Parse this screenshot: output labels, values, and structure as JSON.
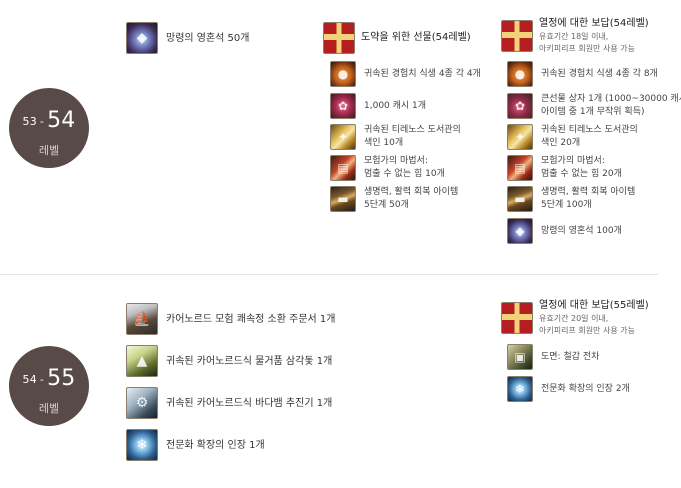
{
  "levels": [
    {
      "from": "53",
      "dash": "-",
      "to": "54",
      "label": "레벨"
    },
    {
      "from": "54",
      "dash": "-",
      "to": "55",
      "label": "레벨"
    }
  ],
  "section1": {
    "col1": [
      {
        "icon": "crystal-icon",
        "text": "망령의 영혼석 50개"
      }
    ],
    "col2": {
      "header": {
        "icon": "gift-box-icon",
        "title": "도약을 위한 선물(54레벨)"
      },
      "items": [
        {
          "icon": "pumpkin-icon",
          "line1": "귀속된 경험치 식생 4종 각 4개",
          "line2": ""
        },
        {
          "icon": "cash-icon",
          "line1": "1,000 캐시 1개",
          "line2": ""
        },
        {
          "icon": "book-icon",
          "line1": "귀속된 티레노스 도서관의",
          "line2": "색인 10개"
        },
        {
          "icon": "magic-book-icon",
          "line1": "모험가의 마법서:",
          "line2": "멈출 수 없는 힘 10개"
        },
        {
          "icon": "potion-icon",
          "line1": "생명력, 활력 회복 아이템",
          "line2": "5단계 50개"
        }
      ]
    },
    "col3": {
      "header": {
        "icon": "gift-box-icon",
        "title": "열정에 대한 보답(54레벨)",
        "sub1": "유효기간 18일 이내,",
        "sub2": "아키피리프 회원만 사용 가능"
      },
      "items": [
        {
          "icon": "pumpkin-icon",
          "line1": "귀속된 경험치 식생 4종 각 8개",
          "line2": ""
        },
        {
          "icon": "mystery-box-icon",
          "line1": "큰선물 상자 1개 (1000~30000 캐시",
          "line2": "아이템 중 1개 무작위 획득)"
        },
        {
          "icon": "book-icon",
          "line1": "귀속된 티레노스 도서관의",
          "line2": "색인 20개"
        },
        {
          "icon": "magic-book-icon",
          "line1": "모험가의 마법서:",
          "line2": "멈출 수 없는 힘 20개"
        },
        {
          "icon": "potion-icon",
          "line1": "생명력, 활력 회복 아이템",
          "line2": "5단계 100개"
        },
        {
          "icon": "crystal-icon",
          "line1": "망령의 영혼석 100개",
          "line2": ""
        }
      ]
    }
  },
  "section2": {
    "col1": [
      {
        "icon": "ship-icon",
        "text": "카어노르드 모험 쾌속정 소환 주문서 1개"
      },
      {
        "icon": "sail-icon",
        "text": "귀속된 카어노르드식 물거품 삼각돛 1개"
      },
      {
        "icon": "engine-icon",
        "text": "귀속된 카어노르드식 바다뱀 추진기 1개"
      },
      {
        "icon": "snowflake-seal-icon",
        "text": "전문화 확장의 인장 1개"
      }
    ],
    "col3": {
      "header": {
        "icon": "gift-box-icon",
        "title": "열정에 대한 보답(55레벨)",
        "sub1": "유효기간 20일 이내,",
        "sub2": "아키피리프 회원만 사용 가능"
      },
      "items": [
        {
          "icon": "tank-blueprint-icon",
          "line1": "도면: 철갑 전차",
          "line2": ""
        },
        {
          "icon": "snowflake-seal-icon",
          "line1": "전문화 확장의 인장 2개",
          "line2": ""
        }
      ]
    }
  }
}
